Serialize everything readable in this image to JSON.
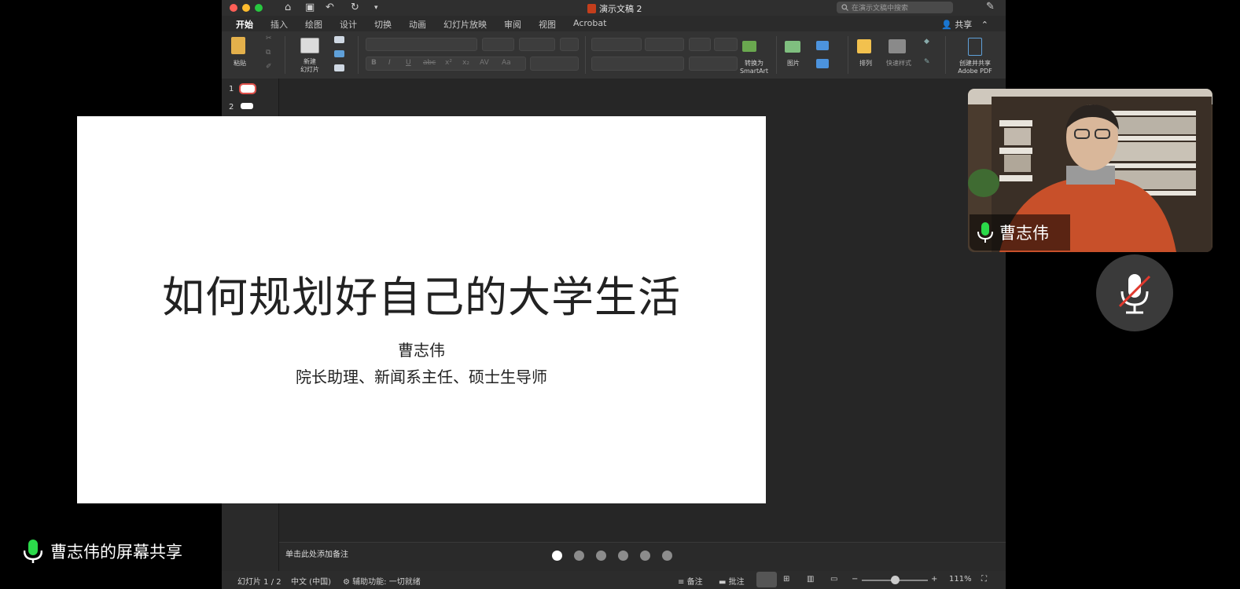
{
  "window": {
    "doc_title": "演示文稿 2",
    "search_placeholder": "在演示文稿中搜索",
    "share_label": "共享"
  },
  "tabs": [
    "开始",
    "插入",
    "绘图",
    "设计",
    "切换",
    "动画",
    "幻灯片放映",
    "审阅",
    "视图",
    "Acrobat"
  ],
  "ribbon": {
    "paste": "粘贴",
    "new_slide_l1": "新建",
    "new_slide_l2": "幻灯片",
    "convert_l1": "转换为",
    "convert_l2": "SmartArt",
    "picture": "图片",
    "arrange": "排列",
    "quick_styles": "快速样式",
    "create_share_l1": "创建并共享",
    "create_share_l2": "Adobe PDF"
  },
  "thumbnails": [
    "1",
    "2"
  ],
  "slide": {
    "title": "如何规划好自己的大学生活",
    "author": "曹志伟",
    "role": "院长助理、新闻系主任、硕士生导师"
  },
  "notes_placeholder": "单击此处添加备注",
  "status": {
    "slide_count": "幻灯片 1 / 2",
    "language": "中文 (中国)",
    "accessibility": "辅助功能: 一切就绪",
    "notes": "备注",
    "comments": "批注",
    "zoom": "111%"
  },
  "pager": {
    "count": 6,
    "active": 1
  },
  "meeting": {
    "participant_name": "曹志伟",
    "screen_share_label": "曹志伟的屏幕共享"
  },
  "colors": {
    "accent_red": "#e0504a",
    "mic_green": "#2bd94a",
    "mute_red": "#e0392e"
  }
}
